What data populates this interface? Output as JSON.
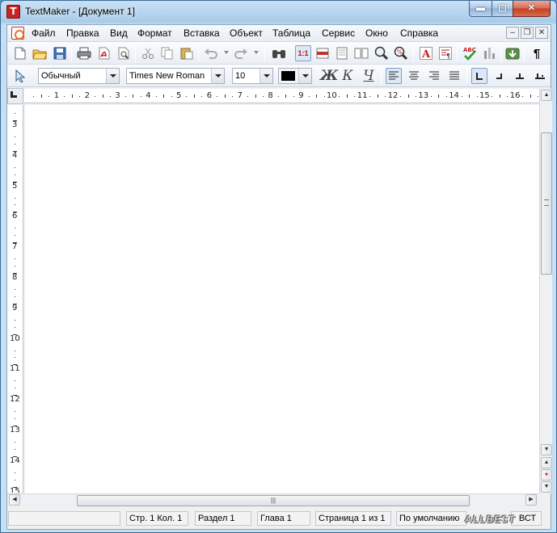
{
  "window": {
    "title": "TextMaker - [Документ 1]",
    "app_icon_letter": "T",
    "min_glyph": "▬",
    "max_glyph": "▢",
    "close_glyph": "✕"
  },
  "menu": {
    "items": [
      "Файл",
      "Правка",
      "Вид",
      "Формат",
      "Вставка",
      "Объект",
      "Таблица",
      "Сервис",
      "Окно",
      "Справка"
    ],
    "mdi_minimize": "–",
    "mdi_restore": "❐",
    "mdi_close": "✕"
  },
  "toolbar_standard": {
    "icons": [
      "new-document-icon",
      "open-folder-icon",
      "save-icon",
      "print-icon",
      "export-pdf-icon",
      "print-preview-icon",
      "cut-icon",
      "copy-icon",
      "paste-icon",
      "undo-icon",
      "redo-icon",
      "find-icon",
      "zoom-1-1-icon",
      "page-width-icon",
      "single-page-icon",
      "two-pages-icon",
      "zoom-icon",
      "zoom-percent-icon",
      "font-color-icon",
      "paragraph-style-icon",
      "spellcheck-icon",
      "tools-icon",
      "download-icon",
      "pilcrow-icon"
    ],
    "zoom_label": "1:1",
    "spell_label": "ABC"
  },
  "toolbar_format": {
    "style_value": "Обычный",
    "font_value": "Times New Roman",
    "size_value": "10",
    "color_value": "#000000",
    "bold_label": "Ж",
    "italic_label": "К",
    "underline_label": "Ч"
  },
  "ruler": {
    "horizontal_numbers": [
      "1",
      "2",
      "3",
      "4",
      "5",
      "6",
      "7",
      "8",
      "9",
      "10",
      "11",
      "12",
      "13",
      "14",
      "15",
      "16"
    ],
    "vertical_numbers": [
      "3",
      "4",
      "5",
      "6",
      "7",
      "8",
      "9",
      "10",
      "11",
      "12",
      "13",
      "14",
      "15"
    ]
  },
  "scrollbar": {
    "up": "▲",
    "down": "▼",
    "left": "◀",
    "right": "▶",
    "prev_page": "▲",
    "browse": "●",
    "next_page": "▼",
    "grip": "|||"
  },
  "status": {
    "cells": [
      "",
      "Стр. 1 Кол. 1",
      "Раздел 1",
      "Глава 1",
      "Страница 1 из 1",
      "По умолчанию",
      "ВСТ"
    ],
    "watermark": "ALLBEST"
  }
}
